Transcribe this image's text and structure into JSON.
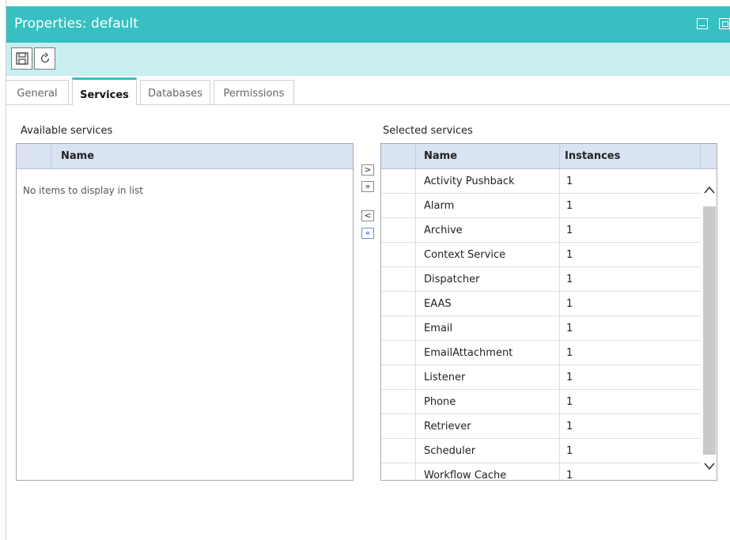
{
  "window": {
    "title": "Properties: default",
    "accent_color": "#37bfc1",
    "toolbar_color": "#c8eef0"
  },
  "toolbar": {
    "save_icon": "save-icon",
    "refresh_icon": "refresh-icon"
  },
  "tabs": [
    {
      "label": "General",
      "active": false
    },
    {
      "label": "Services",
      "active": true
    },
    {
      "label": "Databases",
      "active": false
    },
    {
      "label": "Permissions",
      "active": false
    }
  ],
  "available": {
    "label": "Available services",
    "column_name": "Name",
    "empty_message": "No items to display in list"
  },
  "transfer": {
    "add_one": ">",
    "add_all": "»",
    "remove_one": "<",
    "remove_all": "«"
  },
  "selected": {
    "label": "Selected services",
    "column_name": "Name",
    "column_instances": "Instances",
    "rows": [
      {
        "name": "Activity Pushback",
        "instances": "1"
      },
      {
        "name": "Alarm",
        "instances": "1"
      },
      {
        "name": "Archive",
        "instances": "1"
      },
      {
        "name": "Context Service",
        "instances": "1"
      },
      {
        "name": "Dispatcher",
        "instances": "1"
      },
      {
        "name": "EAAS",
        "instances": "1"
      },
      {
        "name": "Email",
        "instances": "1"
      },
      {
        "name": "EmailAttachment",
        "instances": "1"
      },
      {
        "name": "Listener",
        "instances": "1"
      },
      {
        "name": "Phone",
        "instances": "1"
      },
      {
        "name": "Retriever",
        "instances": "1"
      },
      {
        "name": "Scheduler",
        "instances": "1"
      },
      {
        "name": "Workflow Cache",
        "instances": "1"
      }
    ]
  }
}
